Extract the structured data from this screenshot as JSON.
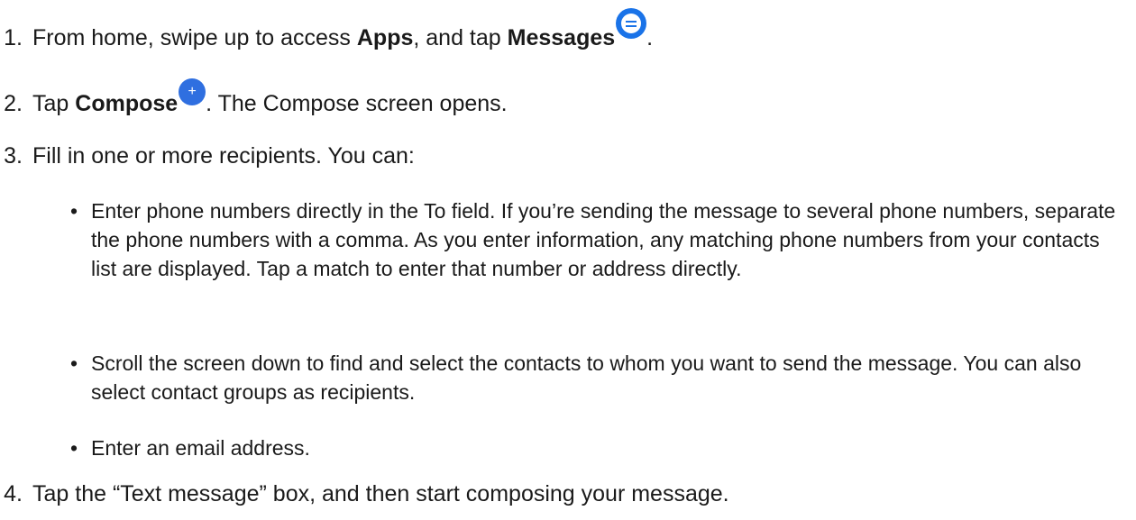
{
  "steps": [
    {
      "num": "1.",
      "pre": "From home, swipe up to access ",
      "b1": "Apps",
      "mid": ", and tap ",
      "b2": "Messages",
      "post": "."
    },
    {
      "num": "2.",
      "pre": "Tap ",
      "b1": "Compose",
      "icon": "+",
      "post": ". The Compose screen opens."
    },
    {
      "num": "3.",
      "text": "Fill in one or more recipients. You can:"
    },
    {
      "num": "4.",
      "text": "Tap the “Text message” box, and then start composing your message."
    }
  ],
  "bullets": [
    {
      "glyph": "•",
      "text": "Enter phone numbers directly in the To field. If you’re sending the message to several phone numbers, separate the phone numbers with a comma. As you enter information, any matching phone numbers from your contacts list are displayed. Tap a match to enter that number or address directly."
    },
    {
      "glyph": "•",
      "text": "Scroll the screen down to find and select the contacts to whom you want to send the message. You can also select contact groups as recipients."
    },
    {
      "glyph": "•",
      "text": "Enter an email address."
    }
  ],
  "icons": {
    "messages": "messages-app-icon",
    "compose": "compose-plus-icon"
  },
  "colors": {
    "accent": "#1a73e8"
  }
}
